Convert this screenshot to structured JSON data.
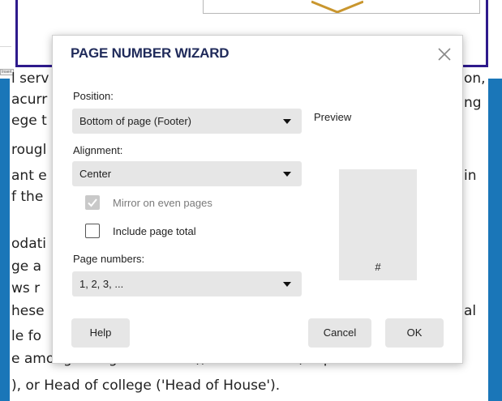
{
  "document": {
    "toolbar_tab": "Insert",
    "lines": [
      "l serv",
      "acurr",
      "ege t",
      "rougl",
      "ant e",
      "f the",
      "odati",
      "ge a",
      "ws r",
      "hese",
      "le fo",
      "e among college members), Senior Tutor (responsible for",
      "), or Head of college ('Head of House')."
    ],
    "right_fragments": [
      "on,",
      "ng",
      "in",
      "al"
    ]
  },
  "dialog": {
    "title": "PAGE NUMBER WIZARD",
    "close_icon": "close-x-icon",
    "position": {
      "label": "Position:",
      "value": "Bottom of page (Footer)"
    },
    "alignment": {
      "label": "Alignment:",
      "value": "Center"
    },
    "mirror": {
      "label": "Mirror on even pages",
      "checked": true,
      "disabled": true
    },
    "include_total": {
      "label": "Include page total",
      "checked": false
    },
    "page_numbers": {
      "label": "Page numbers:",
      "value": "1, 2, 3, ..."
    },
    "preview": {
      "label": "Preview",
      "marker": "#"
    },
    "buttons": {
      "help": "Help",
      "cancel": "Cancel",
      "ok": "OK"
    }
  },
  "colors": {
    "accent_blue": "#1a76b8",
    "frame_purple": "#2e1a8c",
    "title": "#1f2a5a",
    "control_bg": "#e6e6e6"
  }
}
